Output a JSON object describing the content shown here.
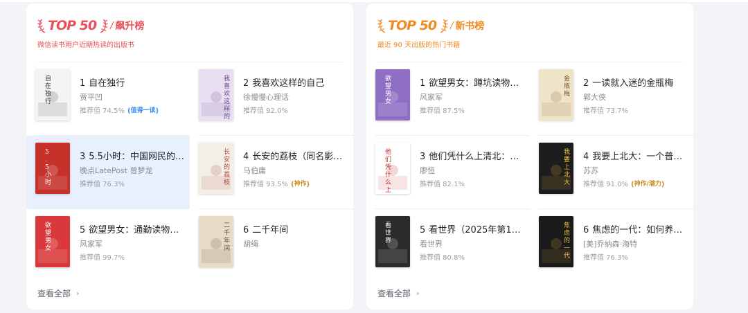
{
  "boards": [
    {
      "logo_text": "TOP 50",
      "name": "飙升榜",
      "subtitle": "微信读书用户近期热读的出版书",
      "footer_label": "查看全部",
      "books": [
        {
          "rank": "1",
          "title": "自在独行",
          "author": "贾平凹",
          "rec": "推荐值 74.5%",
          "badge": "值得一读",
          "badge_color": "blue",
          "cover": {
            "bg": "#f4f4f2",
            "fg": "#333333",
            "text": "自在独行"
          }
        },
        {
          "rank": "2",
          "title": "我喜欢这样的自己",
          "author": "徐慢慢心理话",
          "rec": "推荐值 92.0%",
          "badge": "",
          "cover": {
            "bg": "#e9dff2",
            "fg": "#6b4d8c",
            "text": "我喜欢这样的自己"
          }
        },
        {
          "rank": "3",
          "title": "5.5小时：中国网民的数字…",
          "author": "晚点LatePost 曾梦龙",
          "rec": "推荐值 76.3%",
          "badge": "",
          "selected": true,
          "cover": {
            "bg": "#c7312a",
            "fg": "#ffffff",
            "text": "5.5小时"
          }
        },
        {
          "rank": "4",
          "title": "长安的荔枝（同名影视原著）",
          "author": "马伯庸",
          "rec": "推荐值 93.5%",
          "badge": "神作",
          "badge_color": "gold",
          "cover": {
            "bg": "#f3efe6",
            "fg": "#b0423a",
            "text": "长安的荔枝"
          }
        },
        {
          "rank": "5",
          "title": "欲望男女：通勤读物…",
          "author": "风家军",
          "rec": "推荐值 99.7%",
          "badge": "",
          "cover": {
            "bg": "#d9393b",
            "fg": "#ffffff",
            "text": "欲望男女"
          }
        },
        {
          "rank": "6",
          "title": "二千年间",
          "author": "胡绳",
          "rec": "",
          "badge": "",
          "cover": {
            "bg": "#e8dcc6",
            "fg": "#5a4a35",
            "text": "二千年间"
          }
        }
      ]
    },
    {
      "logo_text": "TOP 50",
      "name": "新书榜",
      "subtitle": "最近 90 天出版的热门书籍",
      "footer_label": "查看全部",
      "books": [
        {
          "rank": "1",
          "title": "欲望男女：蹲坑读物…",
          "author": "风家军",
          "rec": "推荐值 87.5%",
          "badge": "",
          "cover": {
            "bg": "#8e6fc4",
            "fg": "#ffffff",
            "text": "欲望男女"
          }
        },
        {
          "rank": "2",
          "title": "一读就入迷的金瓶梅",
          "author": "郭大侠",
          "rec": "推荐值 73.7%",
          "badge": "",
          "cover": {
            "bg": "#efe3c9",
            "fg": "#7a5a2c",
            "text": "金瓶梅"
          }
        },
        {
          "rank": "3",
          "title": "他们凭什么上清北：…",
          "author": "廖恒",
          "rec": "推荐值 82.1%",
          "badge": "",
          "cover": {
            "bg": "#ffffff",
            "fg": "#c1272d",
            "text": "他们凭什么上清北"
          }
        },
        {
          "rank": "4",
          "title": "我要上北大：一个普…",
          "author": "苏苏",
          "rec": "推荐值 91.0%",
          "badge": "神作/潜力",
          "badge_color": "gold",
          "cover": {
            "bg": "#1d1d1f",
            "fg": "#f2c230",
            "text": "我要上北大"
          }
        },
        {
          "rank": "5",
          "title": "看世界（2025年第1…",
          "author": "看世界",
          "rec": "推荐值 80.8%",
          "badge": "",
          "cover": {
            "bg": "#2b2b2e",
            "fg": "#ffffff",
            "text": "看世界"
          }
        },
        {
          "rank": "6",
          "title": "焦虑的一代：如何养…",
          "author": "[美]乔纳森·海特",
          "rec": "推荐值 76.3%",
          "badge": "",
          "cover": {
            "bg": "#1a1a1a",
            "fg": "#e9b949",
            "text": "焦虑的一代"
          }
        }
      ]
    }
  ]
}
